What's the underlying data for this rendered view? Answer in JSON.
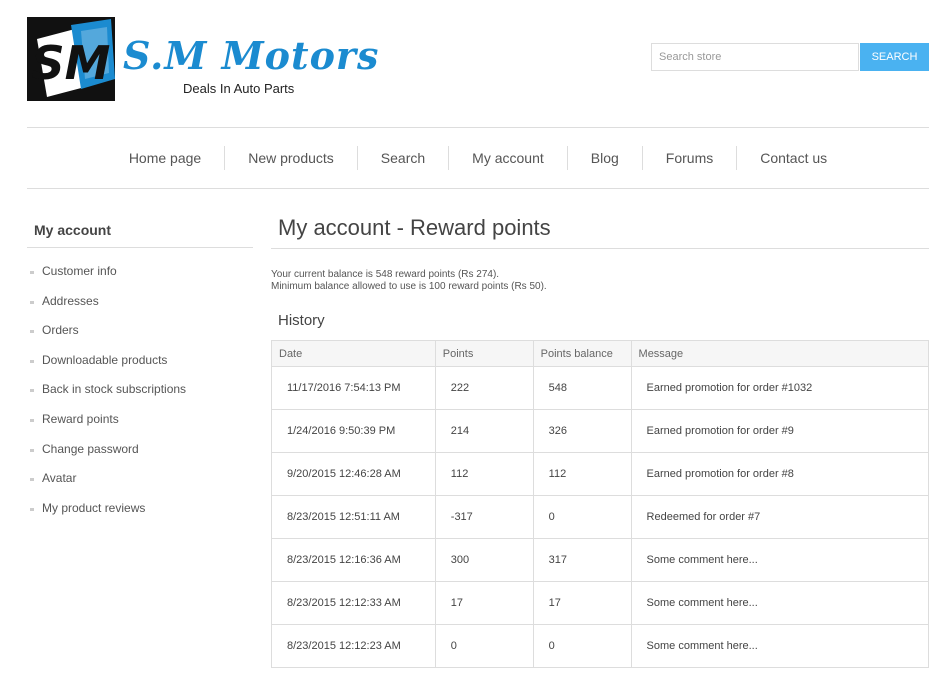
{
  "header": {
    "brand_initials": "SM",
    "brand_name": "S.M Motors",
    "brand_tagline": "Deals In Auto Parts",
    "search": {
      "placeholder": "Search store",
      "button_label": "SEARCH"
    },
    "colors": {
      "accent": "#4ab2f1",
      "brand": "#1b8bd0"
    }
  },
  "nav": {
    "items": [
      {
        "label": "Home page"
      },
      {
        "label": "New products"
      },
      {
        "label": "Search"
      },
      {
        "label": "My account"
      },
      {
        "label": "Blog"
      },
      {
        "label": "Forums"
      },
      {
        "label": "Contact us"
      }
    ]
  },
  "sidebar": {
    "title": "My account",
    "items": [
      {
        "label": "Customer info"
      },
      {
        "label": "Addresses"
      },
      {
        "label": "Orders"
      },
      {
        "label": "Downloadable products"
      },
      {
        "label": "Back in stock subscriptions"
      },
      {
        "label": "Reward points"
      },
      {
        "label": "Change password"
      },
      {
        "label": "Avatar"
      },
      {
        "label": "My product reviews"
      }
    ]
  },
  "main": {
    "title": "My account - Reward points",
    "balance_line1": "Your current balance is 548 reward points (Rs 274).",
    "balance_line2": "Minimum balance allowed to use is 100 reward points (Rs 50).",
    "history_title": "History",
    "columns": [
      "Date",
      "Points",
      "Points balance",
      "Message"
    ],
    "rows": [
      [
        "11/17/2016 7:54:13 PM",
        "222",
        "548",
        "Earned promotion for order #1032"
      ],
      [
        "1/24/2016 9:50:39 PM",
        "214",
        "326",
        "Earned promotion for order #9"
      ],
      [
        "9/20/2015 12:46:28 AM",
        "112",
        "112",
        "Earned promotion for order #8"
      ],
      [
        "8/23/2015 12:51:11 AM",
        "-317",
        "0",
        "Redeemed for order #7"
      ],
      [
        "8/23/2015 12:16:36 AM",
        "300",
        "317",
        "Some comment here..."
      ],
      [
        "8/23/2015 12:12:33 AM",
        "17",
        "17",
        "Some comment here..."
      ],
      [
        "8/23/2015 12:12:23 AM",
        "0",
        "0",
        "Some comment here..."
      ]
    ]
  }
}
